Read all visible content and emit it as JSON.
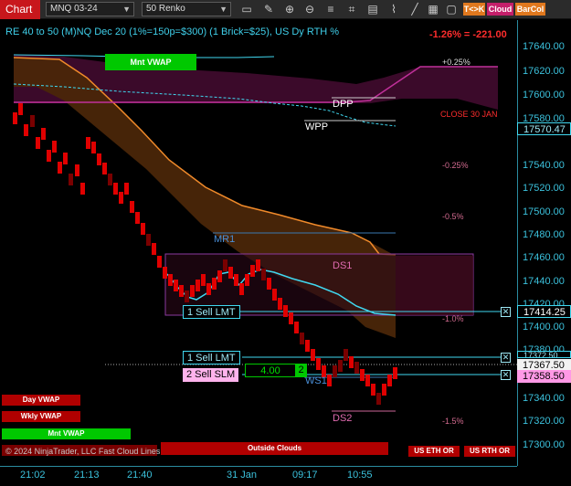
{
  "toolbar": {
    "title": "Chart",
    "instrument": "MNQ 03-24",
    "interval": "50 Renko",
    "btn_tk": "T<>K",
    "btn_cloud": "Cloud",
    "btn_barcol": "BarCol",
    "icons": [
      "ruler-icon",
      "pencil-icon",
      "zoom-in-icon",
      "zoom-out-icon",
      "properties-icon",
      "strategy-icon",
      "chart-trader-icon",
      "tpo-icon"
    ]
  },
  "header": {
    "text": "RE 40 to 50 (M)NQ Dec 20 (1%=150p=$300) (1 Brick=$25), US Dy RTH %",
    "pnl": "-1.26% = -221.00"
  },
  "y_axis": {
    "ticks": [
      "17640.00",
      "17620.00",
      "17600.00",
      "17580.00",
      "17540.00",
      "17520.00",
      "17500.00",
      "17480.00",
      "17460.00",
      "17440.00",
      "17420.00",
      "17400.00",
      "17380.00",
      "17340.00",
      "17320.00",
      "17300.00"
    ]
  },
  "price_tags": {
    "p1": "17570.47",
    "p2": "17414.25",
    "p3": "17372.50",
    "p4": "17367.50",
    "p5": "17358.50"
  },
  "x_axis": {
    "ticks": [
      "21:02",
      "21:13",
      "21:40",
      "31 Jan",
      "09:17",
      "10:55"
    ]
  },
  "levels": {
    "dpp": "DPP",
    "wpp": "WPP",
    "mr1": "MR1",
    "ds1": "DS1",
    "ws1": "WS1",
    "ds2": "DS2",
    "close": "CLOSE 30 JAN"
  },
  "pcts": [
    "+0.25%",
    "-0.25%",
    "-0.5%",
    "-1.0%",
    "-1.5%"
  ],
  "orders": {
    "sell_lmt_1": "1 Sell LMT",
    "sell_lmt_2": "1 Sell LMT",
    "sell_slm": "2 Sell SLM",
    "position_qty": "4.00",
    "position_count": "2",
    "close_x": "x"
  },
  "labels": {
    "mnt_vwap_top": "Mnt VWAP",
    "day_vwap": "Day VWAP",
    "wkly_vwap": "Wkly VWAP",
    "mnt_vwap": "Mnt VWAP",
    "outside_clouds": "Outside Clouds",
    "us_eth": "US ETH OR",
    "us_rth": "US RTH OR",
    "copyright": "© 2024 NinjaTrader, LLC   Fast Cloud Lines"
  },
  "colors": {
    "cyan": "#3bc1dc",
    "red_brick": "#e00000",
    "green_vwap": "#00c800",
    "cloud_orange": "#8a4a10",
    "cloud_magenta": "#5a0a3a"
  },
  "chart_data": {
    "type": "renko",
    "bricks_down_from": 17590,
    "bricks_down_to": 17340
  }
}
